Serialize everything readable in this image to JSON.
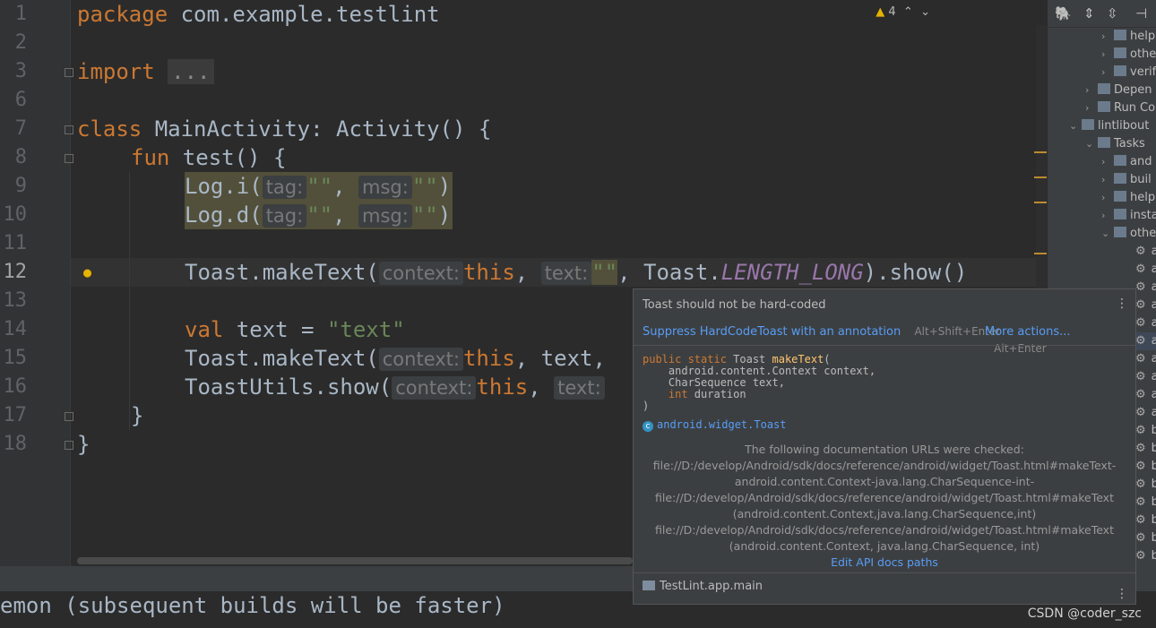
{
  "editor": {
    "line_numbers": [
      "1",
      "2",
      "3",
      "6",
      "7",
      "8",
      "9",
      "10",
      "11",
      "12",
      "13",
      "14",
      "15",
      "16",
      "17",
      "18"
    ],
    "warning_count": "4",
    "lines": {
      "l1_kw": "package",
      "l1_rest": " com.example.testlint",
      "l3_kw": "import",
      "l3_fold": "...",
      "l6": "",
      "l7_kw": "class",
      "l7_rest": " MainActivity: Activity() {",
      "l8_kw": "fun",
      "l8_rest": " test() {",
      "l9_fn": "Log.i(",
      "l9_hint_tag": "tag:",
      "l9_str1": "\"\"",
      "l9_hint_msg": "msg:",
      "l9_str2": "\"\"",
      "l9_close": ")",
      "l10_fn": "Log.d(",
      "l10_hint_tag": "tag:",
      "l10_str1": "\"\"",
      "l10_hint_msg": "msg:",
      "l10_str2": "\"\"",
      "l10_close": ")",
      "l12_fn": "Toast.makeText(",
      "l12_hint_ctx": "context:",
      "l12_this": "this",
      "l12_hint_text": "text:",
      "l12_str": "\"\"",
      "l12_mid": ", Toast.",
      "l12_const": "LENGTH_LONG",
      "l12_end": ").show()",
      "l14_kw": "val",
      "l14_rest": " text = ",
      "l14_str": "\"text\"",
      "l15_fn": "Toast.makeText(",
      "l15_hint_ctx": "context:",
      "l15_this": "this",
      "l15_rest": ", text,",
      "l16_fn": "ToastUtils.show(",
      "l16_hint_ctx": "context:",
      "l16_this": "this",
      "l16_hint_text": "text:",
      "l17": "}",
      "l18": "}"
    }
  },
  "project_tree": {
    "items": [
      "help",
      "othe",
      "verif",
      "Depen",
      "Run Co",
      "lintlibout",
      "Tasks",
      "and",
      "buil",
      "help",
      "insta",
      "othe",
      "a",
      "a",
      "a",
      "a",
      "a",
      "a",
      "a",
      "a",
      "a",
      "a",
      "b",
      "b",
      "b",
      "b",
      "b",
      "b",
      "b",
      "b"
    ]
  },
  "popup": {
    "title": "Toast should not be hard-coded",
    "suppress_label": "Suppress HardCodeToast with an annotation",
    "suppress_key": "Alt+Shift+Enter",
    "more_label": "More actions...",
    "more_key": "Alt+Enter",
    "signature": {
      "kw1": "public static",
      "type": " Toast ",
      "name": "makeText",
      "open": "(",
      "p1": "    android.content.Context context,",
      "p2": "    CharSequence text,",
      "p3_kw": "    int",
      "p3_rest": " duration",
      "close": ")"
    },
    "class_ref": "android.widget.Toast",
    "docs_heading": "The following documentation URLs were checked:",
    "docs_lines": [
      "file://D:/develop/Android/sdk/docs/reference/android/widget/Toast.html#makeText-",
      "android.content.Context-java.lang.CharSequence-int-",
      "file://D:/develop/Android/sdk/docs/reference/android/widget/Toast.html#makeText",
      "(android.content.Context,java.lang.CharSequence,int)",
      "file://D:/develop/Android/sdk/docs/reference/android/widget/Toast.html#makeText",
      "(android.content.Context, java.lang.CharSequence, int)"
    ],
    "edit_link": "Edit API docs paths",
    "module": "TestLint.app.main"
  },
  "console": {
    "text": "emon (subsequent builds will be faster)"
  },
  "watermark": "CSDN @coder_szc",
  "colors": {
    "editor_bg": "#2b2b2b",
    "keyword": "#cc7832",
    "string": "#6a8759",
    "link": "#589df6",
    "warning": "#e5b200"
  }
}
